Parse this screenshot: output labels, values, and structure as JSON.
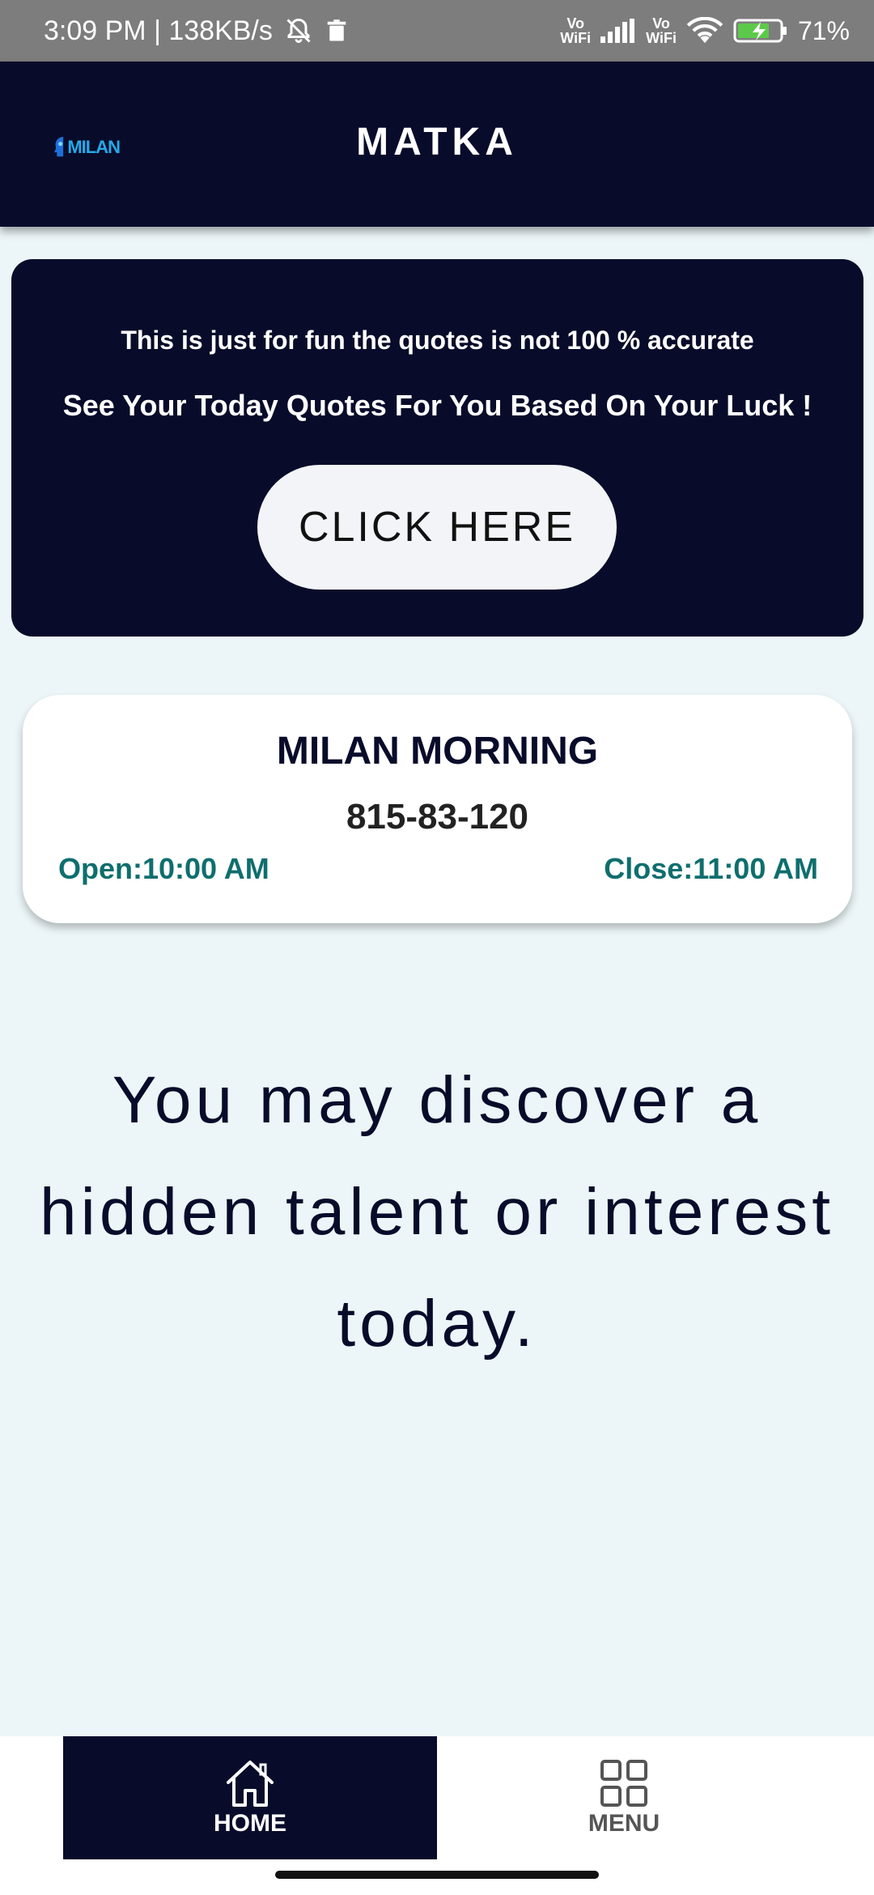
{
  "status_bar": {
    "time_speed": "3:09 PM | 138KB/s",
    "vowifi_1_top": "Vo",
    "vowifi_1_bottom": "WiFi",
    "vowifi_2_top": "Vo",
    "vowifi_2_bottom": "WiFi",
    "battery": "71%"
  },
  "header": {
    "logo_text": "MILAN",
    "title": "MATKA"
  },
  "promo": {
    "disclaimer": "This is just for fun the quotes is not 100 % accurate",
    "headline": "See Your Today Quotes For You Based On Your Luck !",
    "button_label": "CLICK HERE"
  },
  "market": {
    "name": "MILAN MORNING",
    "result": "815-83-120",
    "open": "Open:10:00 AM",
    "close": "Close:11:00 AM"
  },
  "quote": {
    "text": "You may discover a hidden talent or interest today."
  },
  "bottom_nav": {
    "home_label": "HOME",
    "menu_label": "MENU",
    "active": "HOME"
  },
  "colors": {
    "primary_dark": "#080c2a",
    "background": "#ecf6f8",
    "accent_teal": "#0f6e6e",
    "status_bar": "#7d7d7d"
  }
}
